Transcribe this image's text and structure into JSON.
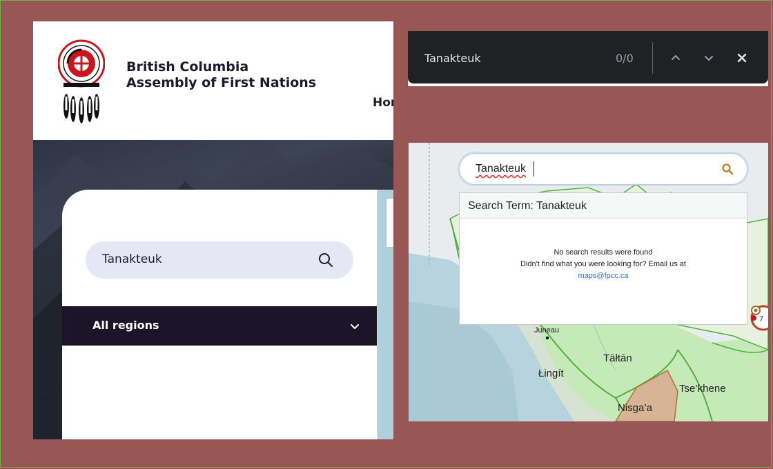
{
  "bc_site": {
    "org_name_line1": "British Columbia",
    "org_name_line2": "Assembly of First Nations",
    "nav_home_partial": "Hor",
    "search_value": "Tanakteuk",
    "region_select": "All regions"
  },
  "find_bar": {
    "query": "Tanakteuk",
    "match_count": "0/0"
  },
  "map": {
    "search_value": "Tanakteuk",
    "results_title": "Search Term: Tanakteuk",
    "no_results": "No search results were found",
    "didnt_find": "Didn't find what you were looking for? Email us at",
    "email": "maps@fpcc.ca",
    "marker_count": "7",
    "labels": {
      "juneau": "Juneau",
      "tahltan": "Tāłtān",
      "lingit": "Łingít",
      "tsekhene": "Tse’khene",
      "nisgaa": "Nisga’a"
    }
  },
  "colors": {
    "frame_bg": "#985655",
    "frame_border": "#6fb24a",
    "bc_dark": "#1c1428",
    "search_pill": "#e6e7f4",
    "findbar_bg": "#202124",
    "map_link": "#2a74c9",
    "territory_green": "#4cb13a"
  }
}
